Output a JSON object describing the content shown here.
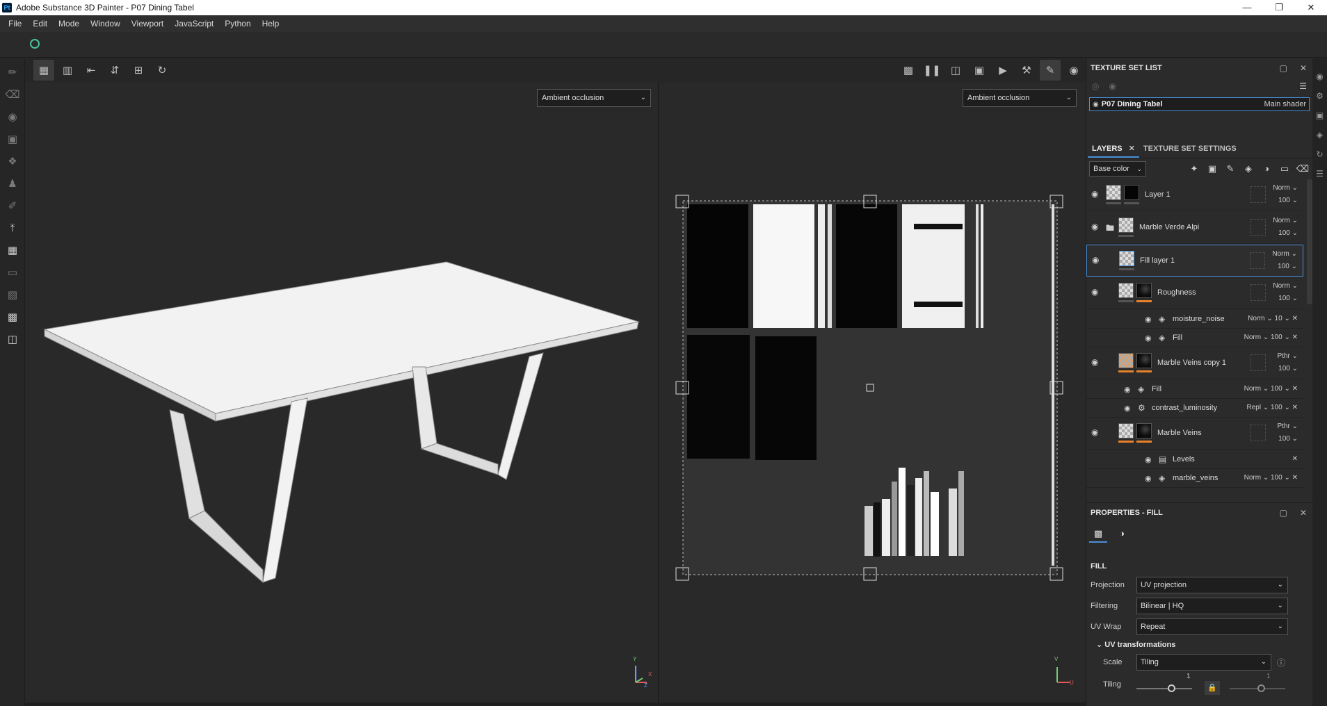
{
  "window": {
    "app_icon": "Pt",
    "title": "Adobe Substance 3D Painter - P07 Dining Tabel",
    "controls": [
      "minimize-icon",
      "restore-icon",
      "close-icon"
    ]
  },
  "menu": [
    "File",
    "Edit",
    "Mode",
    "Window",
    "Viewport",
    "JavaScript",
    "Python",
    "Help"
  ],
  "viewport_3d": {
    "display_mode": "Ambient occlusion",
    "axis_labels": {
      "y": "Y",
      "x": "X",
      "z": "Z"
    }
  },
  "viewport_2d": {
    "display_mode": "Ambient occlusion",
    "axis_labels": {
      "v": "V",
      "u": "U"
    }
  },
  "texture_set_list": {
    "title": "TEXTURE SET LIST",
    "item": {
      "name": "P07 Dining Tabel",
      "shader": "Main shader"
    }
  },
  "layers_panel": {
    "tabs": [
      "LAYERS",
      "TEXTURE SET SETTINGS"
    ],
    "channel": "Base color",
    "layers": [
      {
        "name": "Layer 1",
        "blend": "Norm",
        "opacity": "100"
      },
      {
        "name": "Marble Verde Alpi",
        "blend": "Norm",
        "opacity": "100"
      },
      {
        "name": "Fill layer 1",
        "blend": "Norm",
        "opacity": "100"
      },
      {
        "name": "Roughness",
        "blend": "Norm",
        "opacity": "100"
      },
      {
        "name": "Marble Veins copy 1",
        "blend": "Pthr",
        "opacity": "100"
      },
      {
        "name": "Marble Veins",
        "blend": "Pthr",
        "opacity": "100"
      }
    ],
    "effects": {
      "roughness_1": {
        "name": "moisture_noise",
        "blend": "Norm",
        "opacity": "10"
      },
      "roughness_2": {
        "name": "Fill",
        "blend": "Norm",
        "opacity": "100"
      },
      "copy_1": {
        "name": "Fill",
        "blend": "Norm",
        "opacity": "100"
      },
      "copy_2": {
        "name": "contrast_luminosity",
        "blend": "Repl",
        "opacity": "100"
      },
      "veins_1": {
        "name": "Levels"
      },
      "veins_2": {
        "name": "marble_veins",
        "blend": "Norm",
        "opacity": "100"
      }
    }
  },
  "properties": {
    "title": "PROPERTIES - FILL",
    "section": "FILL",
    "rows": [
      {
        "label": "Projection",
        "value": "UV projection"
      },
      {
        "label": "Filtering",
        "value": "Bilinear | HQ"
      },
      {
        "label": "UV Wrap",
        "value": "Repeat"
      }
    ],
    "uv_transformations": {
      "title": "UV transformations",
      "scale_label": "Scale",
      "scale_value": "Tiling",
      "tiling_label": "Tiling",
      "tiling_u": "1",
      "tiling_v": "1"
    }
  },
  "colors": {
    "accent": "#4a90d9",
    "orange": "#e8822a",
    "green_ring": "#49c39e"
  }
}
